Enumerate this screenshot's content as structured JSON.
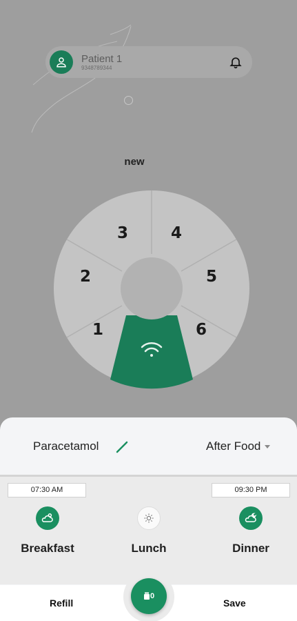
{
  "patient": {
    "name": "Patient 1",
    "phone": "9348789344"
  },
  "device": {
    "name": "new"
  },
  "dial": {
    "slots": [
      "1",
      "2",
      "3",
      "4",
      "5",
      "6"
    ],
    "active_color": "#1a7d58"
  },
  "medicine": {
    "name": "Paracetamol",
    "timing": "After Food"
  },
  "schedule": {
    "breakfast": {
      "time": "07:30 AM",
      "label": "Breakfast",
      "enabled": true
    },
    "lunch": {
      "label": "Lunch",
      "enabled": false
    },
    "dinner": {
      "time": "09:30 PM",
      "label": "Dinner",
      "enabled": true
    }
  },
  "actions": {
    "refill": "Refill",
    "save": "Save",
    "fab_count": "0"
  },
  "colors": {
    "accent": "#1a8f60",
    "background": "#9e9e9e"
  }
}
